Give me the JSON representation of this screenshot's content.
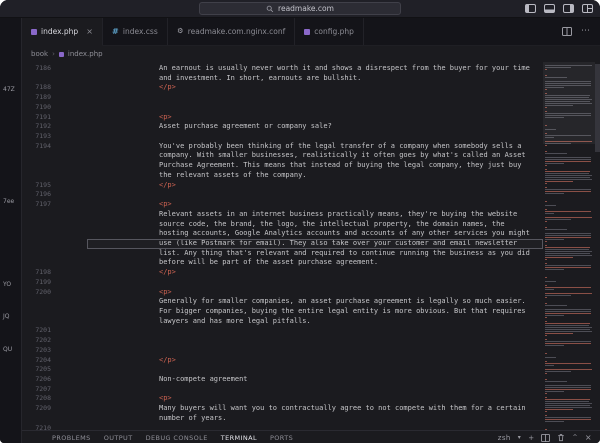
{
  "titlebar": {
    "search_text": "readmake.com",
    "icons": [
      "layout-sidebar-left-icon",
      "layout-panel-icon",
      "layout-sidebar-right-icon",
      "customize-layout-icon"
    ]
  },
  "tabs": [
    {
      "label": "index.php",
      "icon": "php",
      "active": true
    },
    {
      "label": "index.css",
      "icon": "css",
      "active": false
    },
    {
      "label": "readmake.com.nginx.conf",
      "icon": "conf",
      "active": false
    },
    {
      "label": "config.php",
      "icon": "php",
      "active": false
    }
  ],
  "breadcrumb": {
    "items": [
      "book",
      "index.php"
    ],
    "separator": "›"
  },
  "left_strip": {
    "fragments": [
      "47Z",
      "7ee",
      "YO",
      "JQ",
      "QU"
    ]
  },
  "editor": {
    "rows": [
      {
        "num": "7186",
        "kind": "text",
        "text": "An earnout is usually never worth it and shows a disrespect from the buyer for your time"
      },
      {
        "num": "",
        "kind": "text",
        "text": "and investment. In short, earnouts are bullshit."
      },
      {
        "num": "7188",
        "kind": "tag",
        "text": "</p>"
      },
      {
        "num": "7189",
        "kind": "blank",
        "text": ""
      },
      {
        "num": "7190",
        "kind": "blank",
        "text": ""
      },
      {
        "num": "7191",
        "kind": "tag",
        "text": "<p>"
      },
      {
        "num": "7192",
        "kind": "text",
        "text": "Asset purchase agreement or company sale?"
      },
      {
        "num": "7193",
        "kind": "blank",
        "text": ""
      },
      {
        "num": "7194",
        "kind": "text",
        "text": "You've probably been thinking of the legal transfer of a company when somebody sells a"
      },
      {
        "num": "",
        "kind": "text",
        "text": "company. With smaller businesses, realistically it often goes by what's called an Asset"
      },
      {
        "num": "",
        "kind": "text",
        "text": "Purchase Agreement. This means that instead of buying the legal company, they just buy"
      },
      {
        "num": "",
        "kind": "text",
        "text": "the relevant assets of the company."
      },
      {
        "num": "7195",
        "kind": "tag",
        "text": "</p>"
      },
      {
        "num": "7196",
        "kind": "blank",
        "text": ""
      },
      {
        "num": "7197",
        "kind": "tag",
        "text": "<p>"
      },
      {
        "num": "",
        "kind": "text",
        "text": "Relevant assets in an internet business practically means, they're buying the website"
      },
      {
        "num": "",
        "kind": "text",
        "text": "source code, the brand, the logo, the intellectual property, the domain names, the"
      },
      {
        "num": "",
        "kind": "text",
        "text": "hosting accounts, Google Analytics accounts and accounts of any other services you might"
      },
      {
        "num": "",
        "kind": "text",
        "text": "use (like Postmark for email). They also take over your customer and email newsletter",
        "highlight": true
      },
      {
        "num": "",
        "kind": "text",
        "text": "list. Any thing that's relevant and required to continue running the business as you did"
      },
      {
        "num": "",
        "kind": "text",
        "text": "before will be part of the asset purchase agreement."
      },
      {
        "num": "7198",
        "kind": "tag",
        "text": "</p>"
      },
      {
        "num": "7199",
        "kind": "blank",
        "text": ""
      },
      {
        "num": "7200",
        "kind": "tag",
        "text": "<p>"
      },
      {
        "num": "",
        "kind": "text",
        "text": "Generally for smaller companies, an asset purchase agreement is legally so much easier."
      },
      {
        "num": "",
        "kind": "text",
        "text": "For bigger companies, buying the entire legal entity is more obvious. But that requires"
      },
      {
        "num": "",
        "kind": "text",
        "text": "lawyers and has more legal pitfalls."
      },
      {
        "num": "7201",
        "kind": "blank",
        "text": ""
      },
      {
        "num": "7202",
        "kind": "blank",
        "text": ""
      },
      {
        "num": "7203",
        "kind": "blank",
        "text": ""
      },
      {
        "num": "7204",
        "kind": "tag",
        "text": "</p>"
      },
      {
        "num": "7205",
        "kind": "blank",
        "text": ""
      },
      {
        "num": "7206",
        "kind": "text",
        "text": "Non-compete agreement"
      },
      {
        "num": "7207",
        "kind": "blank",
        "text": ""
      },
      {
        "num": "7208",
        "kind": "tag",
        "text": "<p>"
      },
      {
        "num": "7209",
        "kind": "text",
        "text": "Many buyers will want you to contractually agree to not compete with them for a certain"
      },
      {
        "num": "",
        "kind": "text",
        "text": "number of years."
      },
      {
        "num": "7210",
        "kind": "blank",
        "text": ""
      }
    ]
  },
  "panel": {
    "tabs": [
      "PROBLEMS",
      "OUTPUT",
      "DEBUG CONSOLE",
      "TERMINAL",
      "PORTS"
    ],
    "active_tab": "TERMINAL",
    "shell_label": "zsh",
    "icons": [
      "chevron-down-icon",
      "new-terminal-icon",
      "split-terminal-icon",
      "kill-terminal-icon",
      "maximize-panel-icon",
      "close-panel-icon"
    ]
  },
  "colors": {
    "editor_bg": "#1b1b1f",
    "chrome_bg": "#141419",
    "tag_token": "#ce6352",
    "code_text": "#c6c6c9",
    "php_icon": "#8a68c9",
    "css_icon": "#5b9fc7"
  }
}
